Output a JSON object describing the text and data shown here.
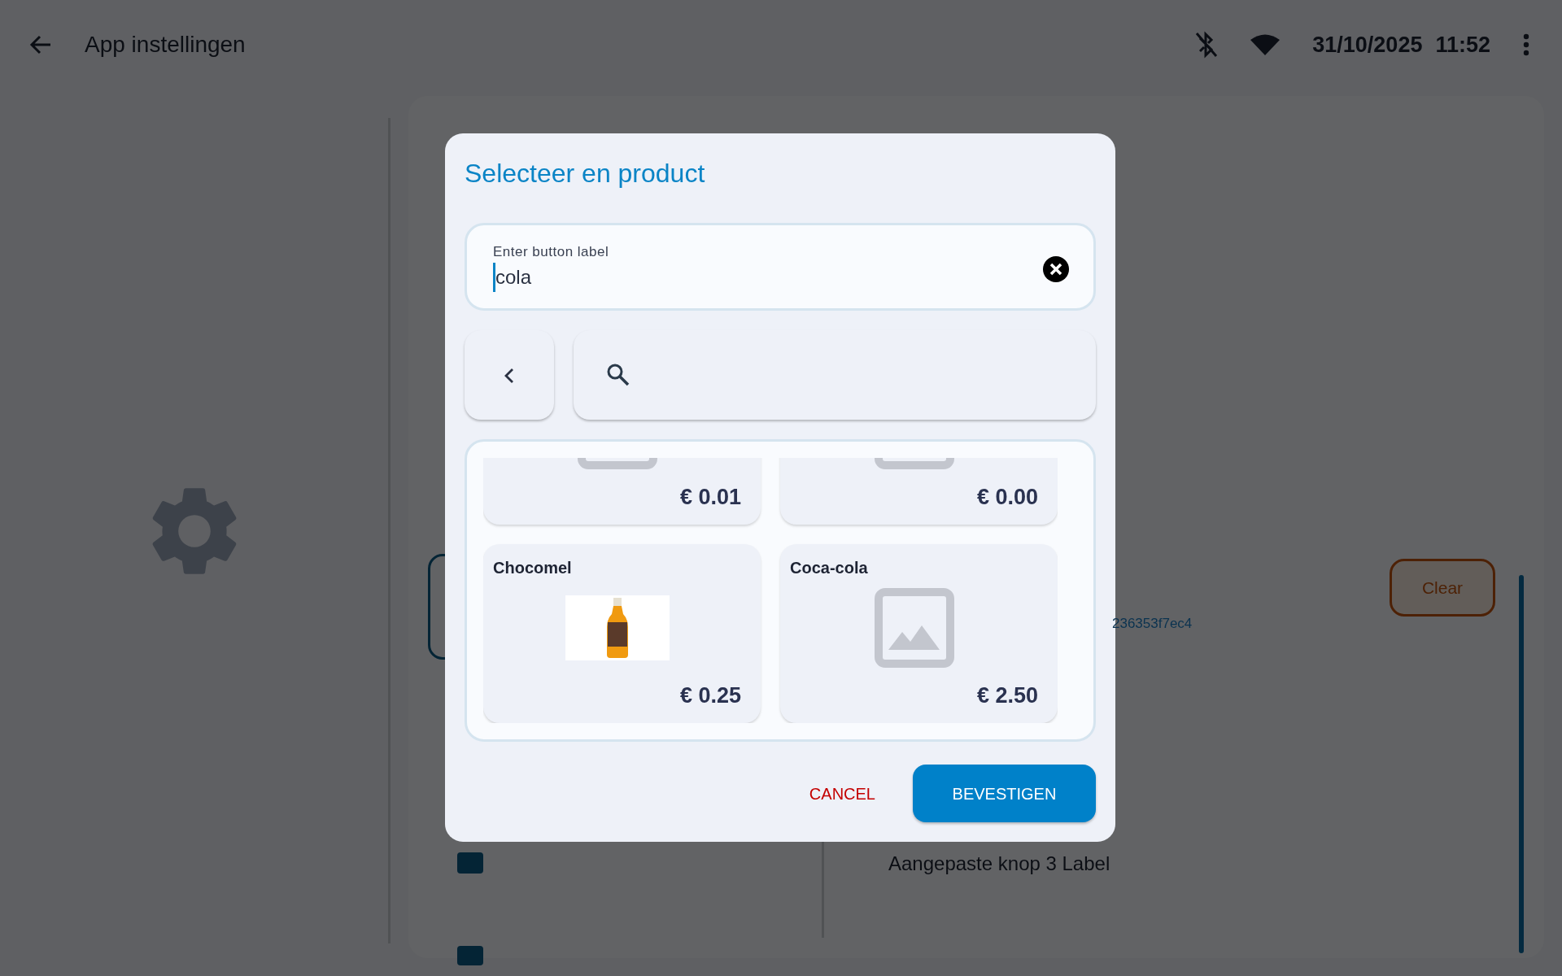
{
  "app_bar": {
    "title": "App instellingen",
    "date": "31/10/2025",
    "time": "11:52"
  },
  "background": {
    "clear_button": "Clear",
    "device_id": "236353f7ec4",
    "custom_label": "Aangepaste knop 3 Label"
  },
  "dialog": {
    "title": "Selecteer en product",
    "label_field": {
      "label": "Enter button label",
      "value": "cola"
    },
    "products": [
      {
        "price": "€ 0.01",
        "kind": "placeholder"
      },
      {
        "price": "€ 0.00",
        "kind": "placeholder"
      },
      {
        "name": "Chocomel",
        "price": "€ 0.25",
        "kind": "photo"
      },
      {
        "name": "Coca-cola",
        "price": "€ 2.50",
        "kind": "placeholder"
      }
    ],
    "buttons": [
      {
        "label": "CANCEL",
        "kind": "text"
      },
      {
        "label": "BEVESTIGEN",
        "kind": "primary"
      }
    ]
  }
}
